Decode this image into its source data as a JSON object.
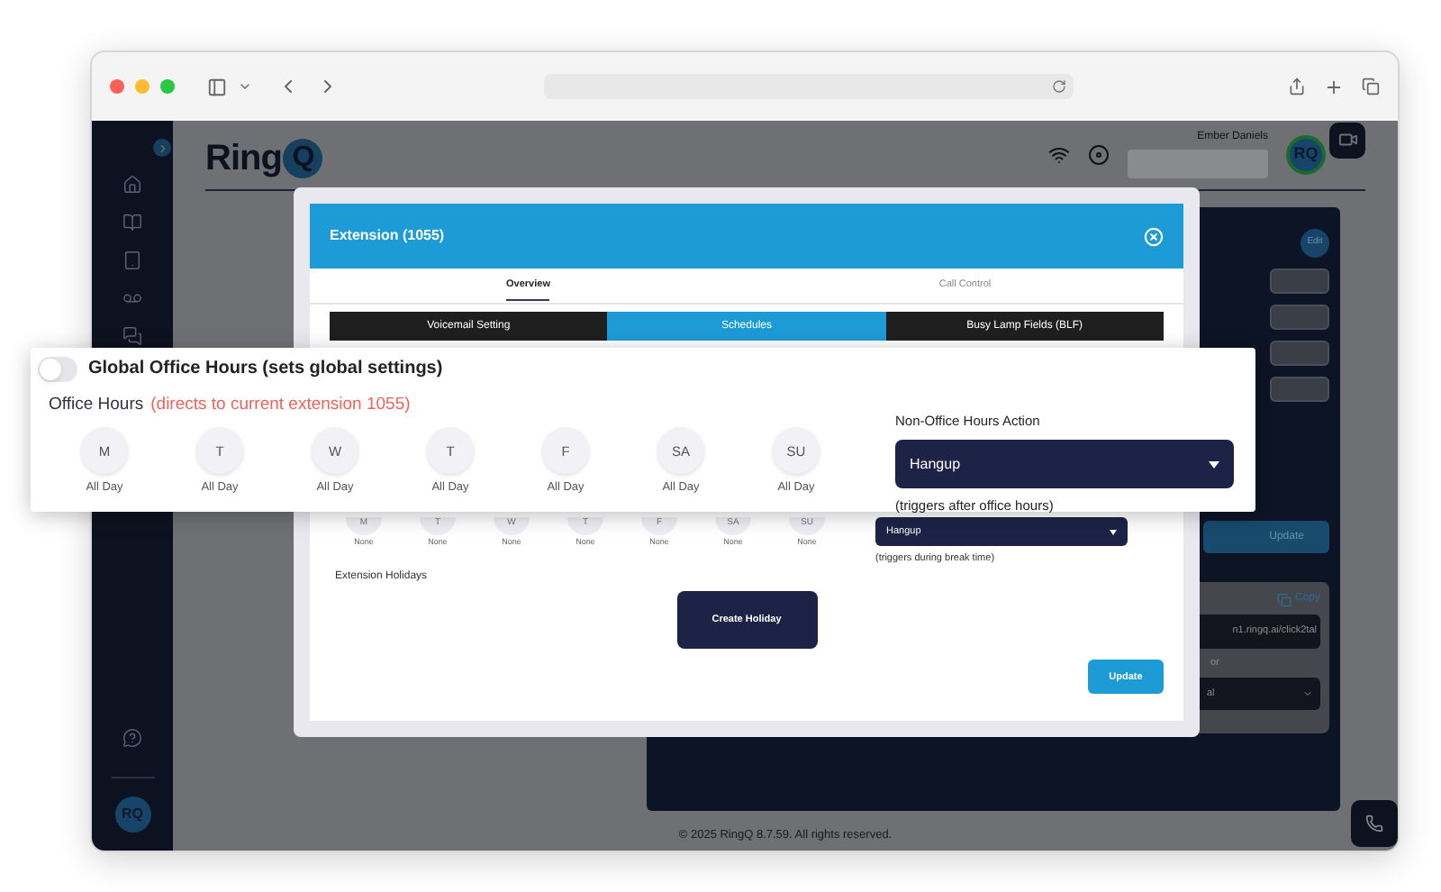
{
  "header": {
    "logo_text": "Ring",
    "logo_mark": "Q",
    "user_name": "Ember Daniels",
    "avatar": "RQ"
  },
  "sidebar": {
    "avatar": "RQ"
  },
  "right_panel": {
    "edit_button": "Edit",
    "update_button": "Update",
    "copy_button": "Copy",
    "link_field": "n1.ringq.ai/click2tal",
    "field_label": "or",
    "select_value": "al"
  },
  "modal": {
    "title": "Extension (1055)",
    "tabs": [
      {
        "label": "Overview",
        "selected": true
      },
      {
        "label": "Call Control",
        "selected": false
      }
    ],
    "subtabs": [
      {
        "label": "Voicemail Setting",
        "selected": false
      },
      {
        "label": "Schedules",
        "selected": true
      },
      {
        "label": "Busy Lamp Fields (BLF)",
        "selected": false
      }
    ],
    "break_days": [
      {
        "day": "M",
        "time": "None"
      },
      {
        "day": "T",
        "time": "None"
      },
      {
        "day": "W",
        "time": "None"
      },
      {
        "day": "T",
        "time": "None"
      },
      {
        "day": "F",
        "time": "None"
      },
      {
        "day": "SA",
        "time": "None"
      },
      {
        "day": "SU",
        "time": "None"
      }
    ],
    "break_action": {
      "value": "Hangup",
      "hint": "(triggers during break time)"
    },
    "holidays_label": "Extension Holidays",
    "create_holiday_button": "Create Holiday",
    "update_button": "Update"
  },
  "callout": {
    "global_toggle": {
      "on": false,
      "label": "Global Office Hours (sets global settings)"
    },
    "office_hours_label": "Office Hours",
    "office_hours_note": "(directs to current extension 1055)",
    "days": [
      {
        "day": "M",
        "time": "All Day"
      },
      {
        "day": "T",
        "time": "All Day"
      },
      {
        "day": "W",
        "time": "All Day"
      },
      {
        "day": "T",
        "time": "All Day"
      },
      {
        "day": "F",
        "time": "All Day"
      },
      {
        "day": "SA",
        "time": "All Day"
      },
      {
        "day": "SU",
        "time": "All Day"
      }
    ],
    "action_label": "Non-Office Hours Action",
    "action": {
      "value": "Hangup",
      "hint": "(triggers after office hours)"
    }
  },
  "footer": "© 2025 RingQ 8.7.59. All rights reserved."
}
